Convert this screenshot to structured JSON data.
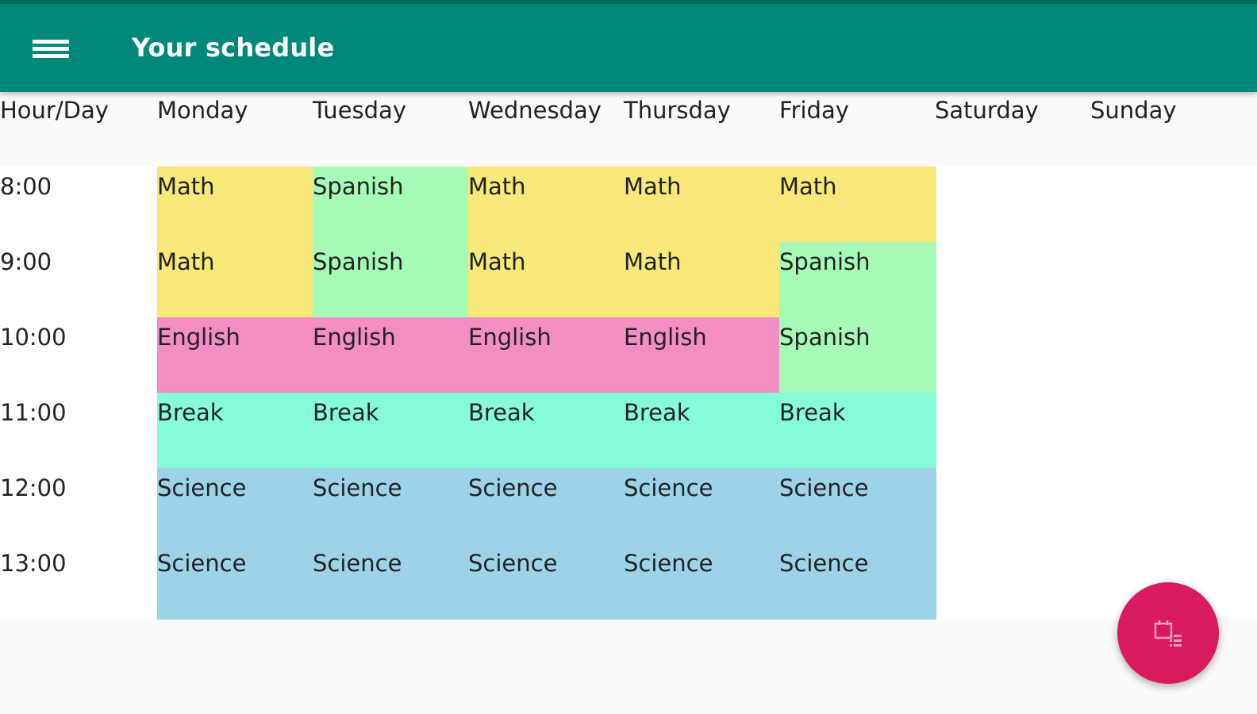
{
  "appbar": {
    "title": "Your schedule",
    "menu_icon": "hamburger-menu-icon",
    "color": "#00897b"
  },
  "table": {
    "corner_label": "Hour/Day",
    "days": [
      "Monday",
      "Tuesday",
      "Wednesday",
      "Thursday",
      "Friday",
      "Saturday",
      "Sunday"
    ],
    "hours": [
      "8:00",
      "9:00",
      "10:00",
      "11:00",
      "12:00",
      "13:00"
    ],
    "rows": [
      [
        "Math",
        "Spanish",
        "Math",
        "Math",
        "Math",
        "",
        ""
      ],
      [
        "Math",
        "Spanish",
        "Math",
        "Math",
        "Spanish",
        "",
        ""
      ],
      [
        "English",
        "English",
        "English",
        "English",
        "Spanish",
        "",
        ""
      ],
      [
        "Break",
        "Break",
        "Break",
        "Break",
        "Break",
        "",
        ""
      ],
      [
        "Science",
        "Science",
        "Science",
        "Science",
        "Science",
        "",
        ""
      ],
      [
        "Science",
        "Science",
        "Science",
        "Science",
        "Science",
        "",
        ""
      ]
    ]
  },
  "subject_colors": {
    "Math": "#f8e878",
    "Spanish": "#a5fbb6",
    "English": "#f48dc4",
    "Break": "#86fbd8",
    "Science": "#9dd3e8"
  },
  "fab": {
    "icon": "calendar-list-icon",
    "color": "#d81b60"
  }
}
